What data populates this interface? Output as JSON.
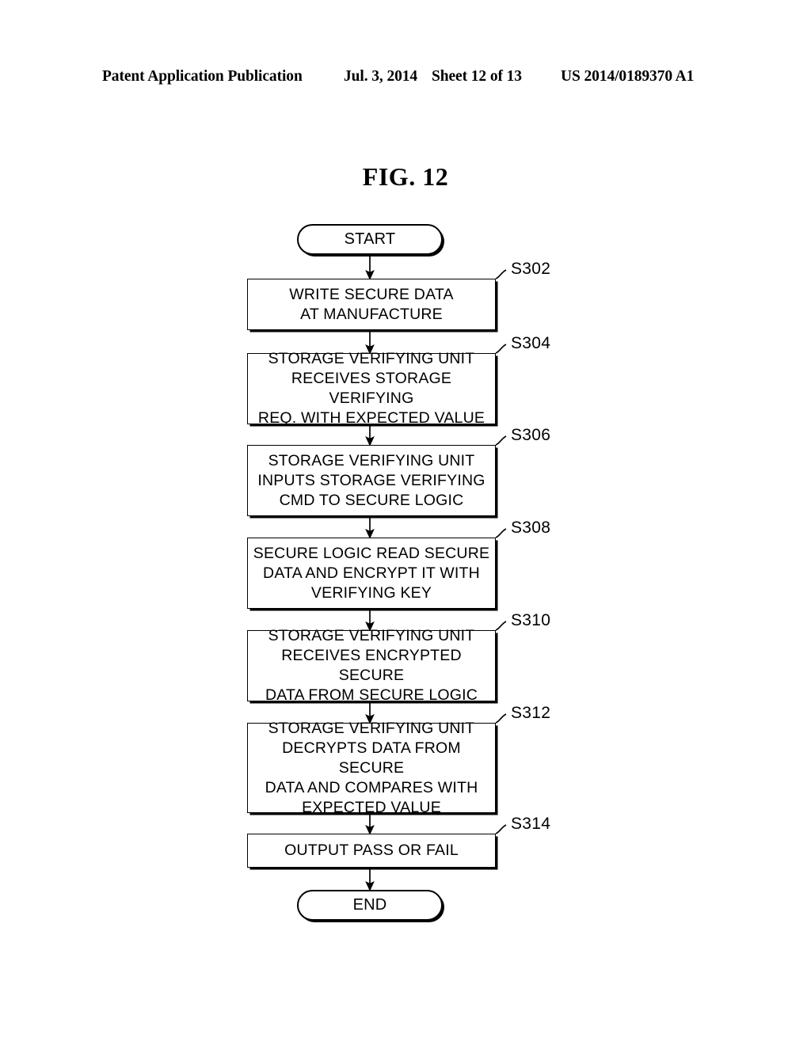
{
  "header": {
    "publication": "Patent Application Publication",
    "date": "Jul. 3, 2014",
    "sheet": "Sheet 12 of 13",
    "patent_number": "US 2014/0189370 A1"
  },
  "figure": {
    "title": "FIG. 12"
  },
  "flowchart": {
    "type": "flowchart",
    "orientation": "top-to-bottom",
    "nodes": [
      {
        "id": "start",
        "shape": "terminator",
        "label": "START",
        "step": null
      },
      {
        "id": "s302",
        "shape": "process",
        "label": "WRITE SECURE DATA\nAT MANUFACTURE",
        "step": "S302"
      },
      {
        "id": "s304",
        "shape": "process",
        "label": "STORAGE VERIFYING UNIT\nRECEIVES STORAGE VERIFYING\nREQ. WITH EXPECTED VALUE",
        "step": "S304"
      },
      {
        "id": "s306",
        "shape": "process",
        "label": "STORAGE VERIFYING UNIT\nINPUTS STORAGE VERIFYING\nCMD TO SECURE LOGIC",
        "step": "S306"
      },
      {
        "id": "s308",
        "shape": "process",
        "label": "SECURE LOGIC READ SECURE\nDATA AND ENCRYPT IT WITH\nVERIFYING KEY",
        "step": "S308"
      },
      {
        "id": "s310",
        "shape": "process",
        "label": "STORAGE VERIFYING UNIT\nRECEIVES ENCRYPTED SECURE\nDATA FROM SECURE LOGIC",
        "step": "S310"
      },
      {
        "id": "s312",
        "shape": "process",
        "label": "STORAGE VERIFYING UNIT\nDECRYPTS DATA FROM SECURE\nDATA AND COMPARES WITH\nEXPECTED VALUE",
        "step": "S312"
      },
      {
        "id": "s314",
        "shape": "process",
        "label": "OUTPUT PASS OR FAIL",
        "step": "S314"
      },
      {
        "id": "end",
        "shape": "terminator",
        "label": "END",
        "step": null
      }
    ],
    "edges": [
      {
        "from": "start",
        "to": "s302",
        "arrow": true
      },
      {
        "from": "s302",
        "to": "s304",
        "arrow": true
      },
      {
        "from": "s304",
        "to": "s306",
        "arrow": true
      },
      {
        "from": "s306",
        "to": "s308",
        "arrow": true
      },
      {
        "from": "s308",
        "to": "s310",
        "arrow": true
      },
      {
        "from": "s310",
        "to": "s312",
        "arrow": true
      },
      {
        "from": "s312",
        "to": "s314",
        "arrow": true
      },
      {
        "from": "s314",
        "to": "end",
        "arrow": true
      }
    ],
    "steps": [
      "S302",
      "S304",
      "S306",
      "S308",
      "S310",
      "S312",
      "S314"
    ],
    "colors": {
      "ink": "#000000",
      "paper": "#ffffff"
    }
  }
}
